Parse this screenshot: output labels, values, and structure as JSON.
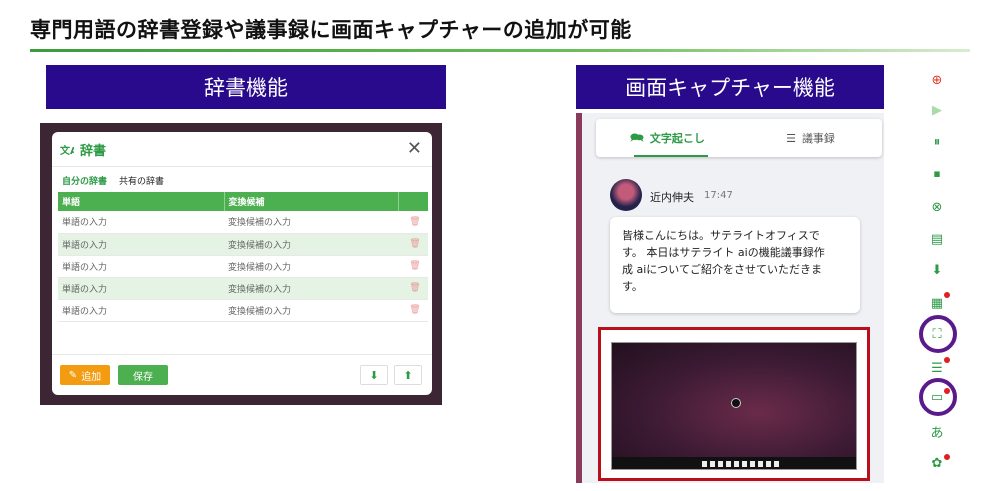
{
  "title": "専門用語の辞書登録や議事録に画面キャプチャーの追加が可能",
  "dictionary_section": {
    "header": "辞書機能",
    "dialog_title": "辞書",
    "close_glyph": "✕",
    "tabs": [
      "自分の辞書",
      "共有の辞書"
    ],
    "columns": [
      "単語",
      "変換候補"
    ],
    "rows": [
      {
        "word": "単語の入力",
        "candidate": "変換候補の入力"
      },
      {
        "word": "単語の入力",
        "candidate": "変換候補の入力"
      },
      {
        "word": "単語の入力",
        "candidate": "変換候補の入力"
      },
      {
        "word": "単語の入力",
        "candidate": "変換候補の入力"
      },
      {
        "word": "単語の入力",
        "candidate": "変換候補の入力"
      }
    ],
    "add_button": "追加",
    "save_button": "保存"
  },
  "capture_section": {
    "header": "画面キャプチャー機能",
    "tabs": [
      "文字起こし",
      "議事録"
    ],
    "speaker": "近内伸夫",
    "time": "17:47",
    "message_lines": [
      "皆様こんにちは。サテライトオフィスで",
      "す。 本日はサテライト aiの機能議事録作",
      "成 aiについてご紹介をさせていただきま",
      "す。"
    ]
  },
  "toolbar_icons": [
    "record-icon",
    "play-icon",
    "pause-icon",
    "stop-icon",
    "cancel-icon",
    "document-icon",
    "clipboard-download-icon",
    "new-doc-icon",
    "screen-capture-icon",
    "list-icon",
    "dictionary-icon",
    "text-a-icon",
    "openai-icon"
  ],
  "toolbar_glyph_a": "あ",
  "colors": {
    "header_bg": "#2a0a8c",
    "accent_green": "#2d9a46",
    "table_header": "#4caf50",
    "highlight_ring": "#5a1a8c",
    "capture_frame": "#b80f1a"
  }
}
